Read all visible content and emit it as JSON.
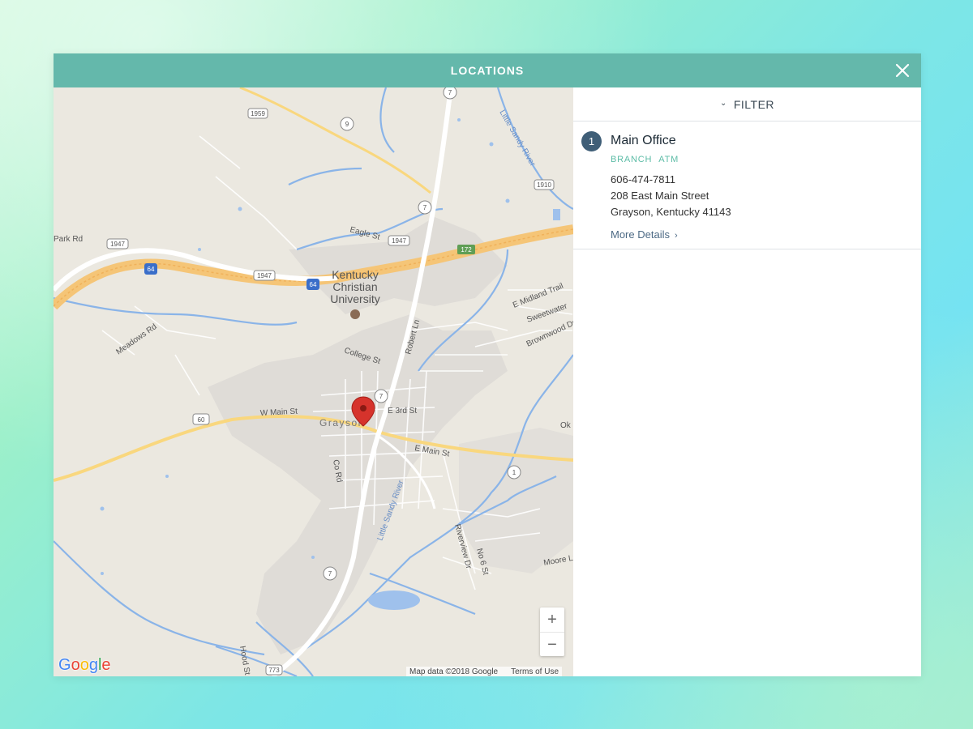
{
  "modal": {
    "title": "LOCATIONS",
    "close_icon": "close-icon"
  },
  "filter": {
    "label": "FILTER",
    "icon": "chevron-down-icon"
  },
  "locations": [
    {
      "number": "1",
      "name": "Main Office",
      "tags": [
        "BRANCH",
        "ATM"
      ],
      "phone": "606-474-7811",
      "address_line1": "208 East Main Street",
      "address_line2": "Grayson, Kentucky 41143",
      "more_label": "More Details",
      "more_icon": "chevron-right-icon"
    }
  ],
  "map": {
    "zoom_in": "+",
    "zoom_out": "−",
    "logo": "Google",
    "attribution": "Map data ©2018 Google",
    "terms": "Terms of Use",
    "labels": {
      "university_1": "Kentucky",
      "university_2": "Christian",
      "university_3": "University",
      "town": "Grayson",
      "w_main": "W Main St",
      "e_main": "E Main St",
      "e_3rd": "E 3rd St",
      "college": "College St",
      "robert": "Robert Ln",
      "e_midland": "E Midland Trail",
      "eagle": "Eagle St",
      "little_sandy_1": "Little Sandy River",
      "little_sandy_2": "Little Sandy River",
      "e_midland_2": "Sweetwater",
      "brownwood": "Brownwood Dr",
      "meadows": "Meadows Rd",
      "co_rd": "Co Rd",
      "riverview": "Riverview Dr",
      "no6": "No 6 St",
      "hood": "Hood St",
      "ok": "Ok",
      "mccoy": "Moore Ln",
      "park": "Park Rd",
      "shield_1959": "1959",
      "shield_9": "9",
      "shield_7a": "7",
      "shield_7b": "7",
      "shield_7c": "7",
      "shield_7d": "7",
      "shield_1947a": "1947",
      "shield_1947b": "1947",
      "shield_1947c": "1947",
      "shield_64a": "64",
      "shield_64b": "64",
      "shield_1910": "1910",
      "shield_172": "172",
      "shield_60": "60",
      "shield_1": "1",
      "shield_773": "773"
    }
  },
  "colors": {
    "header": "#64b8ab",
    "badge": "#3f5e77",
    "tag": "#5cbca6",
    "link": "#4d6a85",
    "water": "#8ab4e8",
    "highway": "#f6c877",
    "marker": "#d6332c"
  }
}
